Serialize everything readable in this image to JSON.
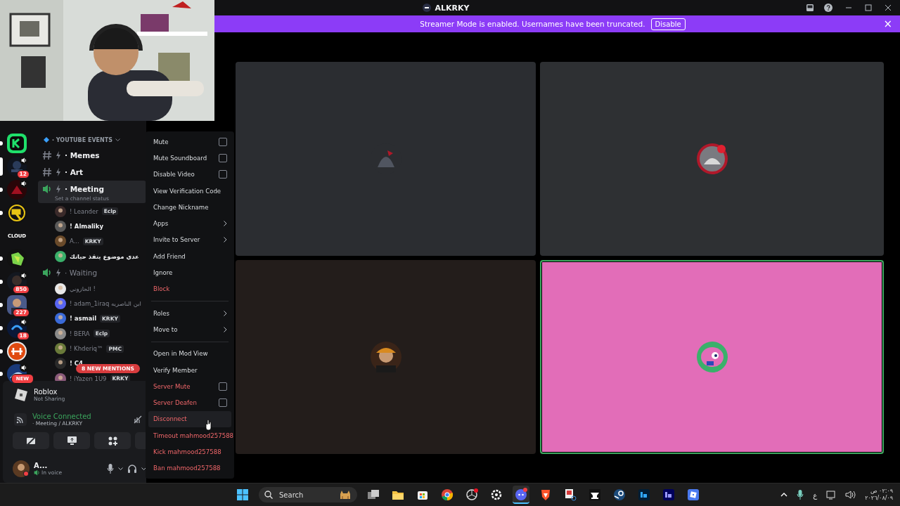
{
  "window": {
    "title": "ALKRKY"
  },
  "banner": {
    "message": "Streamer Mode is enabled. Usernames have been truncated.",
    "action": "Disable",
    "close": "×"
  },
  "servers": [
    {
      "unread": true,
      "selected": false,
      "speaker": false
    },
    {
      "unread": true,
      "selected": true,
      "speaker": true,
      "badge": "12"
    },
    {
      "unread": true,
      "selected": false,
      "speaker": true
    },
    {
      "unread": true,
      "selected": false,
      "speaker": false
    },
    {
      "unread": false,
      "selected": false,
      "speaker": false,
      "label": "CLOUD"
    },
    {
      "unread": true,
      "selected": false,
      "speaker": false
    },
    {
      "unread": true,
      "selected": false,
      "speaker": true,
      "badge": "850"
    },
    {
      "unread": true,
      "selected": false,
      "speaker": false,
      "badge": "227"
    },
    {
      "unread": true,
      "selected": false,
      "speaker": true,
      "badge": "18"
    },
    {
      "unread": true,
      "selected": false,
      "speaker": false
    },
    {
      "unread": true,
      "selected": false,
      "speaker": true,
      "badge": "NEW"
    }
  ],
  "channels": [
    {
      "kind": "category",
      "name": "· YOUTUBE EVENTS"
    },
    {
      "kind": "text",
      "name": "· Memes",
      "selected": false
    },
    {
      "kind": "text",
      "name": "· Art",
      "selected": false
    },
    {
      "kind": "voice",
      "name": "· Meeting",
      "selected": true,
      "status": "Set a channel status",
      "users": [
        {
          "name": "! Leander",
          "tag": "Eclp",
          "bright": false
        },
        {
          "name": "! Almaliky",
          "bright": true
        },
        {
          "name": "A...",
          "tag": "KRKY",
          "bright": false
        },
        {
          "name": "عدي موضوع يتقذ حياتك",
          "bright": true
        }
      ]
    },
    {
      "kind": "voice",
      "name": "· Waiting",
      "selected": false,
      "users": [
        {
          "name": "الحازوني !",
          "bright": false
        },
        {
          "name": "! adam_1iraq ابن الناصريه",
          "bright": false
        },
        {
          "name": "! asmail",
          "tag": "KRKY",
          "bright": true
        },
        {
          "name": "! BERA",
          "tag": "Eclp",
          "bright": false
        },
        {
          "name": "! Khderiq™",
          "tag": "PMC",
          "bright": false
        },
        {
          "name": "! C4",
          "bright": true
        },
        {
          "name": "! iYazen 1U9",
          "tag": "KRKY",
          "bright": false
        }
      ]
    }
  ],
  "mentions": "8 NEW MENTIONS",
  "activity": {
    "title": "Roblox",
    "subtitle": "Not Sharing"
  },
  "voice": {
    "status": "Voice Connected",
    "location": "· Meeting / ALKRKY"
  },
  "user": {
    "name": "A...",
    "status": "In voice"
  },
  "tiles": [
    {
      "speaking": false
    },
    {
      "speaking": false
    },
    {
      "speaking": false
    },
    {
      "speaking": true
    }
  ],
  "menu": [
    [
      {
        "label": "Mute",
        "kind": "check",
        "checked": false,
        "danger": false
      },
      {
        "label": "Mute Soundboard",
        "kind": "check",
        "checked": false,
        "danger": false
      },
      {
        "label": "Disable Video",
        "kind": "check",
        "checked": false,
        "danger": false
      },
      {
        "label": "View Verification Code",
        "kind": "plain",
        "danger": false
      },
      {
        "label": "Change Nickname",
        "kind": "plain",
        "danger": false
      },
      {
        "label": "Apps",
        "kind": "submenu",
        "danger": false
      },
      {
        "label": "Invite to Server",
        "kind": "submenu",
        "danger": false
      },
      {
        "label": "Add Friend",
        "kind": "plain",
        "danger": false
      },
      {
        "label": "Ignore",
        "kind": "plain",
        "danger": false
      },
      {
        "label": "Block",
        "kind": "plain",
        "danger": true
      }
    ],
    [
      {
        "label": "Roles",
        "kind": "submenu",
        "danger": false
      },
      {
        "label": "Move to",
        "kind": "submenu",
        "danger": false
      }
    ],
    [
      {
        "label": "Open in Mod View",
        "kind": "plain",
        "danger": false
      },
      {
        "label": "Verify Member",
        "kind": "plain",
        "danger": false
      },
      {
        "label": "Server Mute",
        "kind": "check",
        "checked": false,
        "danger": true
      },
      {
        "label": "Server Deafen",
        "kind": "check",
        "checked": false,
        "danger": true
      },
      {
        "label": "Disconnect",
        "kind": "plain",
        "danger": true,
        "hovered": true
      },
      {
        "label": "Timeout mahmood257588",
        "kind": "plain",
        "danger": true
      },
      {
        "label": "Kick mahmood257588",
        "kind": "plain",
        "danger": true
      },
      {
        "label": "Ban mahmood257588",
        "kind": "plain",
        "danger": true
      }
    ]
  ],
  "taskbar": {
    "search": "Search",
    "keyboard": "ع",
    "time": "٠٢:٠٩ ص",
    "date": "٢٠٢٦/٠٨/٠٩"
  }
}
